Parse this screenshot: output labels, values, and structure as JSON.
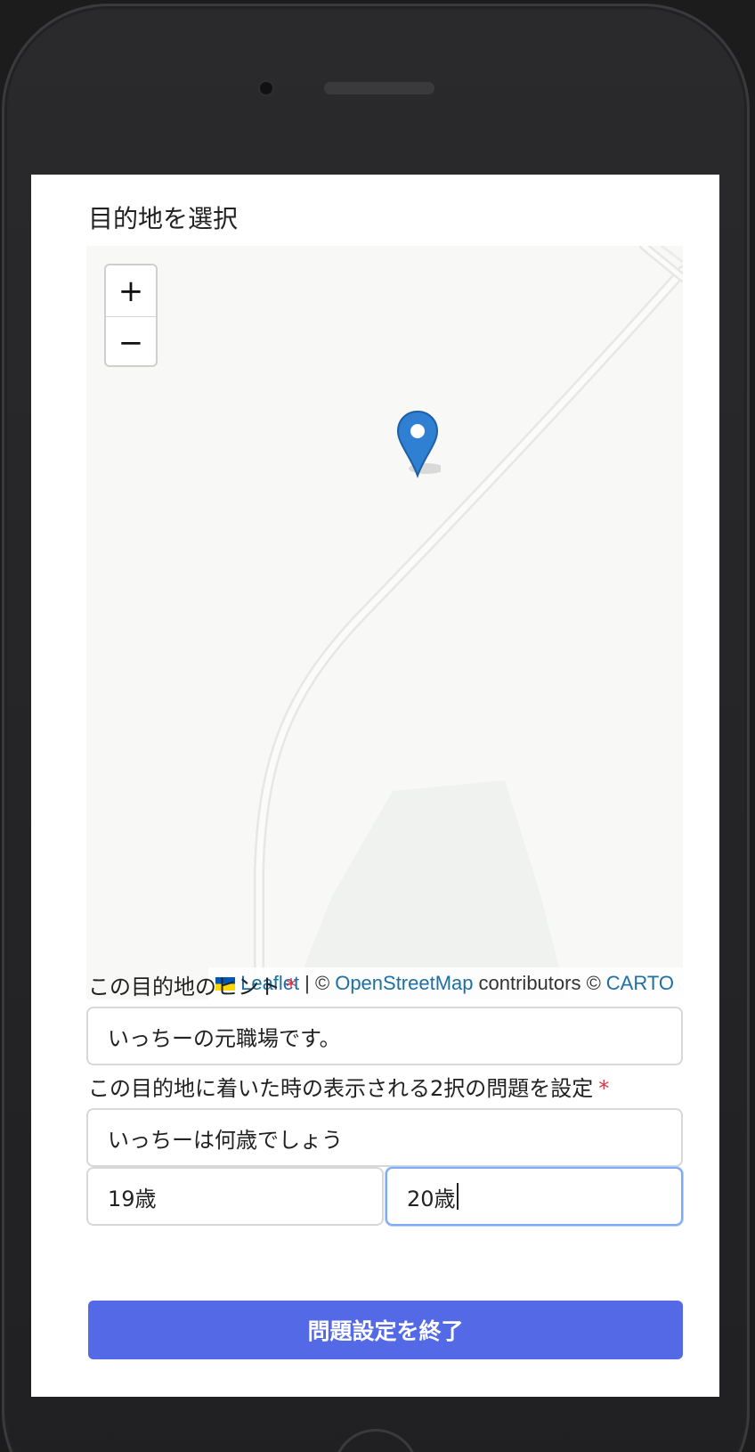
{
  "form": {
    "section_title": "目的地を選択",
    "hint_label": "この目的地のヒント",
    "hint_value": "いっちーの元職場です。",
    "question_label": "この目的地に着いた時の表示される2択の問題を設定",
    "question_value": "いっちーは何歳でしょう",
    "choice_a_value": "19歳",
    "choice_b_value": "20歳",
    "required_mark": "*",
    "submit_label": "問題設定を終了"
  },
  "map": {
    "zoom_in": "+",
    "zoom_out": "−",
    "attribution": {
      "leaflet": "Leaflet",
      "separator": "| ©",
      "osm": "OpenStreetMap",
      "contributors": "contributors ©",
      "carto": "CARTO"
    }
  },
  "colors": {
    "primary_button": "#5469e6",
    "marker": "#2f7fd2",
    "link": "#1d6fa5",
    "required": "#dc3545"
  },
  "icons": {
    "marker": "map-pin-icon",
    "flag": "ukraine-flag-icon"
  }
}
